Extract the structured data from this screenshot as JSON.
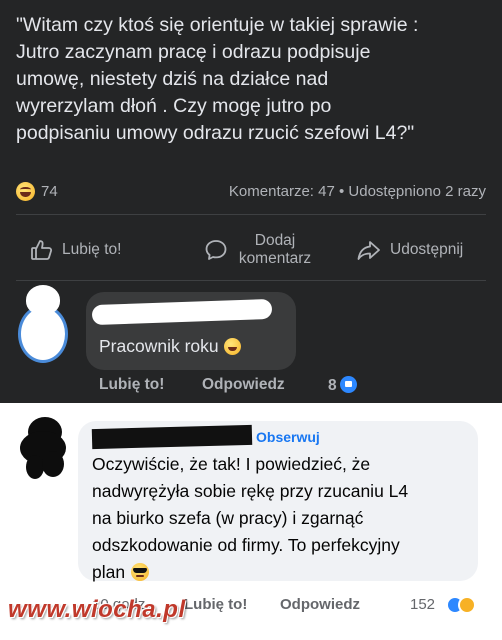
{
  "post": {
    "text": "\"Witam czy ktoś się orientuje w takiej sprawie :\nJutro zaczynam pracę i odrazu podpisuje\numowę, niestety dziś na działce nad\nwyrerzylam dłoń . Czy mogę jutro po\npodpisaniu umowy odrazu rzucić szefowi L4?\"",
    "reaction_icon": "haha-emoji-icon",
    "reaction_count": "74",
    "stats": "Komentarze: 47 • Udostępniono 2 razy"
  },
  "actions": {
    "like": "Lubię to!",
    "comment": "Dodaj\nkomentarz",
    "share": "Udostępnij"
  },
  "comment1": {
    "text": "Pracownik roku",
    "like": "Lubię to!",
    "reply": "Odpowiedz",
    "count": "8"
  },
  "comment2": {
    "follow": "Obserwuj",
    "text": "Oczywiście, że tak! I powiedzieć, że\nnadwyrężyła sobie rękę przy rzucaniu L4\nna biurko szefa (w pracy) i zgarnąć\nodszkodowanie od firmy. To perfekcyjny\nplan",
    "time": "10 godz.",
    "like": "Lubię to!",
    "reply": "Odpowiedz",
    "count": "152"
  },
  "watermark": "www.wiocha.pl",
  "colors": {
    "dark_bg": "#242526",
    "light_bg": "#ffffff",
    "link_blue": "#1877f2",
    "watermark_red": "#c0392b"
  }
}
